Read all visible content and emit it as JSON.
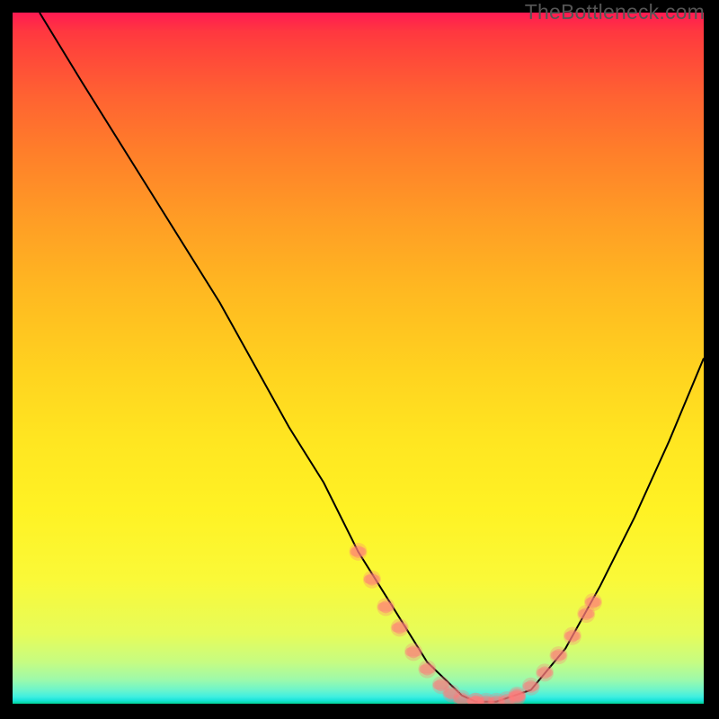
{
  "brand": "TheBottleneck.com",
  "chart_data": {
    "type": "line",
    "title": "",
    "xlabel": "",
    "ylabel": "",
    "xlim": [
      0,
      100
    ],
    "ylim": [
      0,
      100
    ],
    "legend": false,
    "grid": false,
    "background_gradient": {
      "direction": "vertical",
      "stops": [
        {
          "pos": 0,
          "color": "#ff1a52"
        },
        {
          "pos": 50,
          "color": "#ffd31f"
        },
        {
          "pos": 90,
          "color": "#e6fc5a"
        },
        {
          "pos": 100,
          "color": "#1ae3d9"
        }
      ]
    },
    "series": [
      {
        "name": "bottleneck-curve",
        "color": "#000000",
        "x": [
          3.9,
          10,
          20,
          30,
          40,
          45,
          50,
          55,
          60,
          65,
          67,
          70,
          75,
          80,
          85,
          90,
          95,
          100
        ],
        "y": [
          100,
          90,
          74,
          58,
          40,
          32,
          22,
          14,
          6,
          1.2,
          0.3,
          0.3,
          2,
          8,
          17,
          27,
          38,
          50
        ]
      }
    ],
    "markers": [
      {
        "name": "glow-pink-left",
        "color": "#ff7a7a",
        "style": "fuzzy",
        "points": [
          {
            "x": 50,
            "y": 22
          },
          {
            "x": 52,
            "y": 18
          },
          {
            "x": 54,
            "y": 14
          },
          {
            "x": 56,
            "y": 11
          },
          {
            "x": 58,
            "y": 7.5
          },
          {
            "x": 60,
            "y": 5
          },
          {
            "x": 62,
            "y": 2.7
          },
          {
            "x": 63.5,
            "y": 1.5
          },
          {
            "x": 65,
            "y": 0.7
          },
          {
            "x": 67,
            "y": 0.3
          }
        ]
      },
      {
        "name": "glow-pink-bottom",
        "color": "#ff7a7a",
        "style": "fuzzy",
        "points": [
          {
            "x": 67,
            "y": 0.3
          },
          {
            "x": 68.5,
            "y": 0.3
          },
          {
            "x": 70,
            "y": 0.3
          },
          {
            "x": 71.5,
            "y": 0.5
          },
          {
            "x": 73,
            "y": 1.0
          }
        ]
      },
      {
        "name": "glow-pink-right",
        "color": "#ff7a7a",
        "style": "fuzzy",
        "points": [
          {
            "x": 73,
            "y": 1.2
          },
          {
            "x": 75,
            "y": 2.5
          },
          {
            "x": 77,
            "y": 4.5
          },
          {
            "x": 79,
            "y": 7.0
          },
          {
            "x": 81,
            "y": 9.8
          },
          {
            "x": 83,
            "y": 13
          },
          {
            "x": 84,
            "y": 14.7
          }
        ]
      }
    ]
  }
}
